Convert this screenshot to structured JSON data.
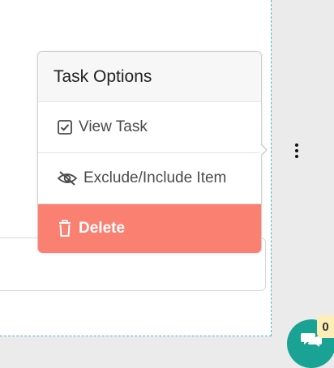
{
  "popover": {
    "title": "Task Options",
    "items": [
      {
        "label": "View Task",
        "icon": "check-square-icon"
      },
      {
        "label": "Exclude/Include Item",
        "icon": "eye-slash-icon"
      },
      {
        "label": "Delete",
        "icon": "trash-icon"
      }
    ]
  },
  "chat": {
    "count": "0",
    "icon": "chat-bubbles-icon"
  },
  "colors": {
    "delete_bg": "#fa8072",
    "chat_bg": "#1aa394",
    "badge_bg": "#fdeeb7",
    "panel_border": "#4bb8c8"
  }
}
